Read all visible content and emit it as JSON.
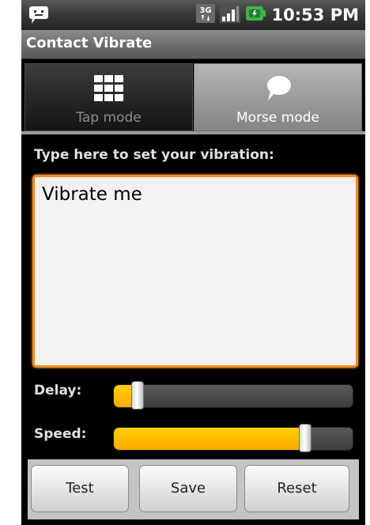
{
  "status_bar": {
    "time": "10:53 PM",
    "icons": [
      "notification-icon",
      "3g-icon",
      "signal-icon",
      "battery-icon"
    ],
    "network_label": "3G"
  },
  "title_bar": {
    "title": "Contact Vibrate"
  },
  "tabs": [
    {
      "label": "Tap mode",
      "icon": "grid-icon",
      "selected": false
    },
    {
      "label": "Morse mode",
      "icon": "speech-bubble-icon",
      "selected": true
    }
  ],
  "prompt": "Type here to set your vibration:",
  "text_area": {
    "value": "Vibrate me"
  },
  "sliders": {
    "delay": {
      "label": "Delay:",
      "value_percent": 10
    },
    "speed": {
      "label": "Speed:",
      "value_percent": 80
    }
  },
  "buttons": {
    "test": "Test",
    "save": "Save",
    "reset": "Reset"
  },
  "colors": {
    "accent": "#f28c1c",
    "slider_fill": "#ffb800"
  }
}
